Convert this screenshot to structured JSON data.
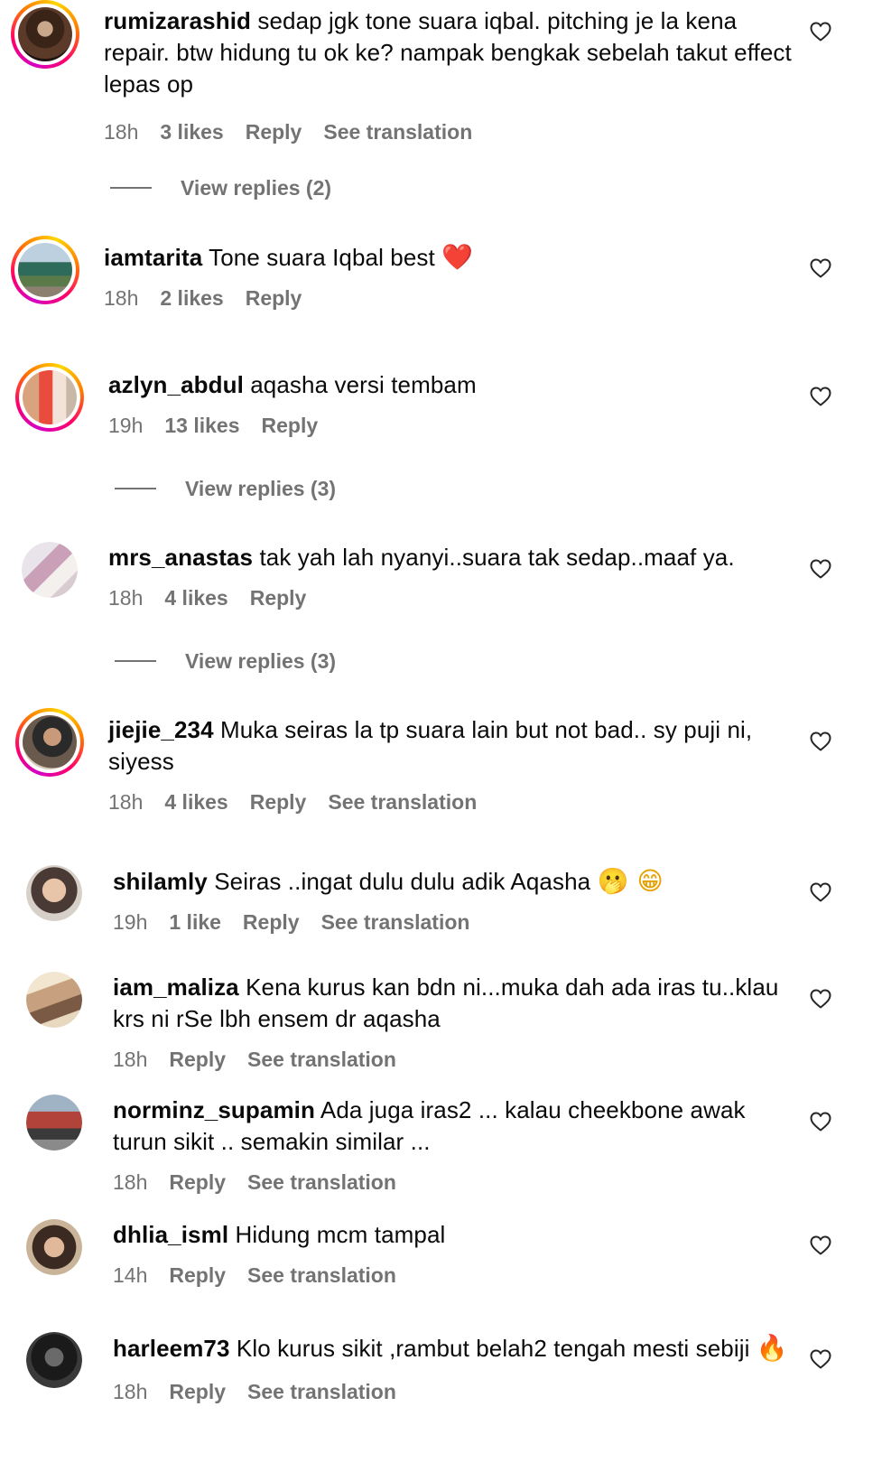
{
  "comments": [
    {
      "username": "rumizarashid",
      "text": "sedap jgk tone suara iqbal. pitching je la kena repair. btw hidung tu ok ke? nampak bengkak sebelah takut effect lepas op",
      "time": "18h",
      "likes": "3 likes",
      "reply": "Reply",
      "translate": "See translation",
      "view_replies": "View replies (2)"
    },
    {
      "username": "iamtarita",
      "text": "Tone suara Iqbal best",
      "emoji": "❤️",
      "time": "18h",
      "likes": "2 likes",
      "reply": "Reply"
    },
    {
      "username": "azlyn_abdul",
      "text": "aqasha versi tembam",
      "time": "19h",
      "likes": "13 likes",
      "reply": "Reply",
      "view_replies": "View replies (3)"
    },
    {
      "username": "mrs_anastas",
      "text": "tak yah lah nyanyi..suara tak sedap..maaf ya.",
      "time": "18h",
      "likes": "4 likes",
      "reply": "Reply",
      "view_replies": "View replies (3)"
    },
    {
      "username": "jiejie_234",
      "text": "Muka seiras la tp suara lain but not bad.. sy puji ni, siyess",
      "time": "18h",
      "likes": "4 likes",
      "reply": "Reply",
      "translate": "See translation"
    },
    {
      "username": "shilamly",
      "text": "Seiras ..ingat dulu dulu adik Aqasha",
      "emoji": "🫢 😁",
      "time": "19h",
      "likes": "1 like",
      "reply": "Reply",
      "translate": "See translation"
    },
    {
      "username": "iam_maliza",
      "text": "Kena kurus kan bdn ni...muka dah ada iras tu..klau krs ni rSe lbh ensem dr aqasha",
      "time": "18h",
      "reply": "Reply",
      "translate": "See translation"
    },
    {
      "username": "norminz_supamin",
      "text": "Ada juga iras2 ... kalau cheekbone awak turun sikit .. semakin similar ...",
      "time": "18h",
      "reply": "Reply",
      "translate": "See translation"
    },
    {
      "username": "dhlia_isml",
      "text": "Hidung mcm tampal",
      "time": "14h",
      "reply": "Reply",
      "translate": "See translation"
    },
    {
      "username": "harleem73",
      "text": "Klo kurus sikit ,rambut belah2 tengah mesti sebiji",
      "emoji": "🔥",
      "time": "18h",
      "reply": "Reply",
      "translate": "See translation"
    }
  ],
  "icons": {
    "like": "heart-outline-icon"
  },
  "colors": {
    "text": "#0a0a0a",
    "secondary": "#737373",
    "story_ring": [
      "#d300c5",
      "#ff0069",
      "#ff7a00",
      "#ffd600"
    ]
  }
}
